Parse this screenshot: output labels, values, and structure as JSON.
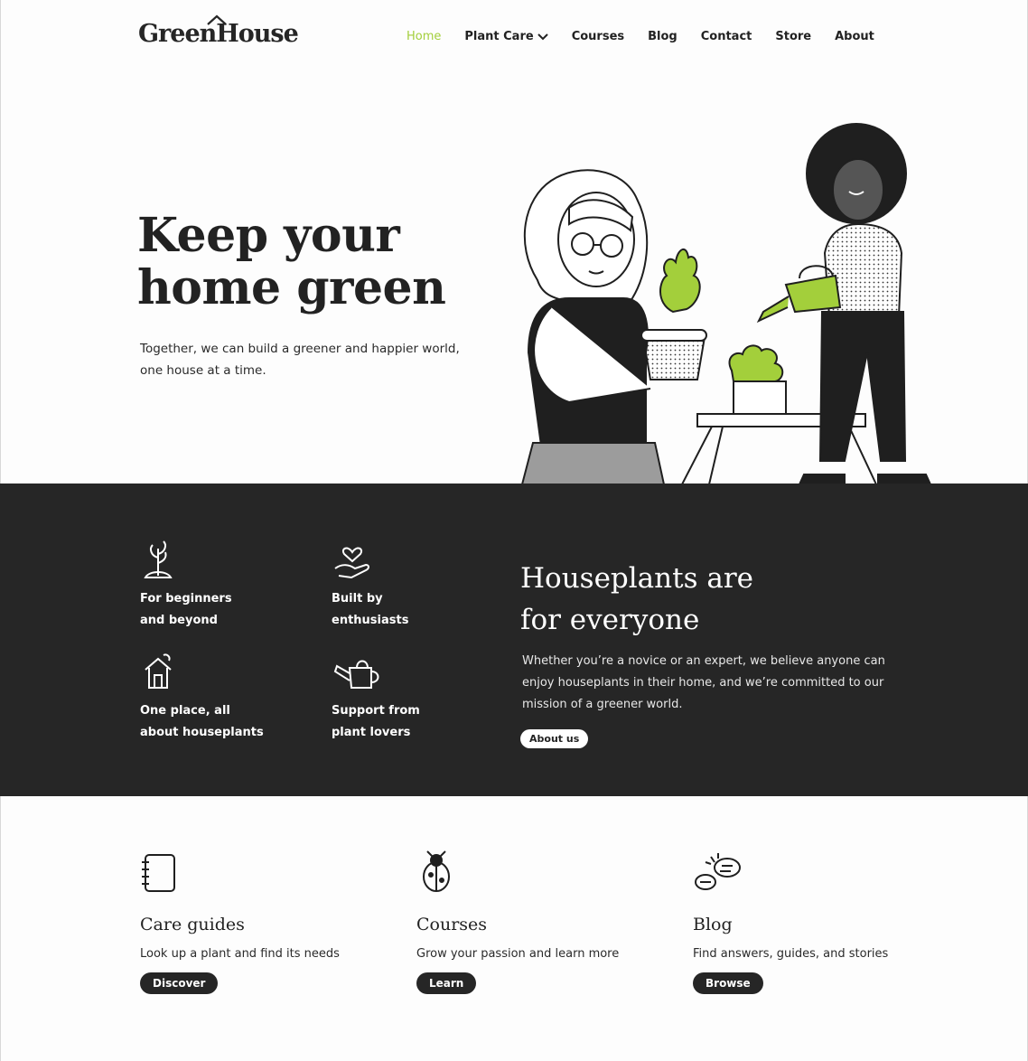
{
  "brand": {
    "name": "GreenHouse",
    "accent": "#a3cf3b",
    "dark": "#262626"
  },
  "nav": {
    "items": [
      {
        "label": "Home",
        "active": true
      },
      {
        "label": "Plant Care",
        "dropdown": true
      },
      {
        "label": "Courses"
      },
      {
        "label": "Blog"
      },
      {
        "label": "Contact"
      },
      {
        "label": "Store"
      },
      {
        "label": "About"
      }
    ]
  },
  "hero": {
    "title_line1": "Keep your",
    "title_line2": "home green",
    "subtitle": "Together, we can build a greener and happier world, one house at a time."
  },
  "features": [
    {
      "icon": "sprout-icon",
      "line1": "For beginners",
      "line2": "and beyond"
    },
    {
      "icon": "heart-hand-icon",
      "line1": "Built by",
      "line2": "enthusiasts"
    },
    {
      "icon": "house-icon",
      "line1": "One place, all",
      "line2": "about houseplants"
    },
    {
      "icon": "watering-can-icon",
      "line1": "Support from",
      "line2": "plant lovers"
    }
  ],
  "band": {
    "title_line1": "Houseplants are",
    "title_line2": "for everyone",
    "text": "Whether you’re a novice or an expert, we believe anyone can enjoy houseplants in their home, and we’re committed to our mission of a greener world.",
    "button": "About us"
  },
  "cards": [
    {
      "icon": "notebook-icon",
      "title": "Care guides",
      "desc": "Look up a plant and find its needs",
      "button": "Discover"
    },
    {
      "icon": "bug-icon",
      "title": "Courses",
      "desc": "Grow your passion and learn more",
      "button": "Learn"
    },
    {
      "icon": "chat-bubbles-icon",
      "title": "Blog",
      "desc": "Find answers, guides, and stories",
      "button": "Browse"
    }
  ]
}
